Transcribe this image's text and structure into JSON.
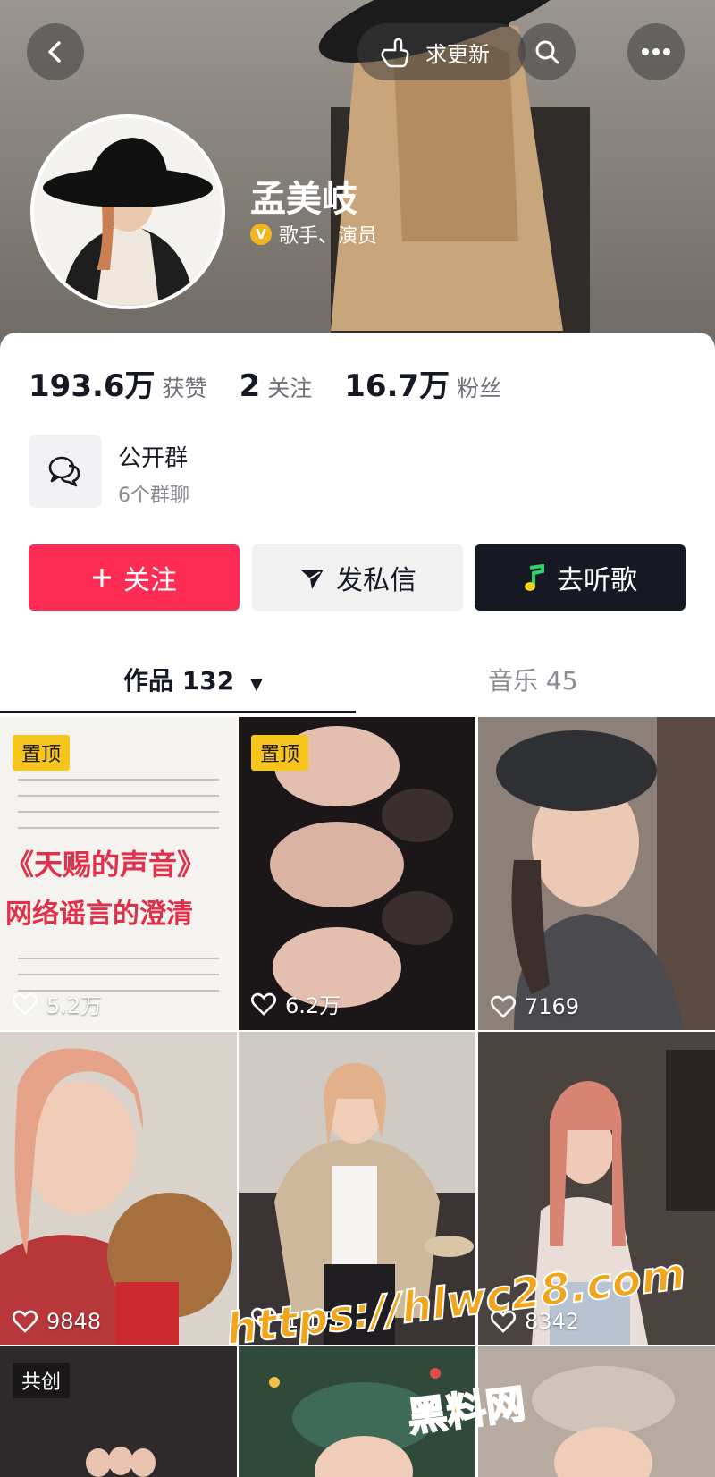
{
  "header": {
    "remind_label": "求更新",
    "name": "孟美岐",
    "verified_icon_letter": "V",
    "verified_text": "歌手、演员"
  },
  "stats": [
    {
      "value": "193.6万",
      "label": "获赞"
    },
    {
      "value": "2",
      "label": "关注"
    },
    {
      "value": "16.7万",
      "label": "粉丝"
    }
  ],
  "group": {
    "title": "公开群",
    "subtitle": "6个群聊"
  },
  "buttons": {
    "follow": "关注",
    "message": "发私信",
    "music": "去听歌"
  },
  "tabs": {
    "works": "作品 132",
    "music": "音乐 45"
  },
  "grid": [
    {
      "likes": "5.2万",
      "badge": "置顶",
      "headline1": "《天赐的声音》",
      "headline2": "网络谣言的澄清"
    },
    {
      "likes": "6.2万",
      "badge": "置顶"
    },
    {
      "likes": "7169"
    },
    {
      "likes": "9848"
    },
    {
      "likes": "1.1万"
    },
    {
      "likes": "8342"
    },
    {
      "badge": "共创"
    },
    {},
    {}
  ],
  "watermark": {
    "line1": "https://hlwc28.com",
    "line2": "黑料网"
  },
  "colors": {
    "primary_red": "#fe2c55",
    "dark": "#161823",
    "pin_yellow": "#f8c51c"
  }
}
